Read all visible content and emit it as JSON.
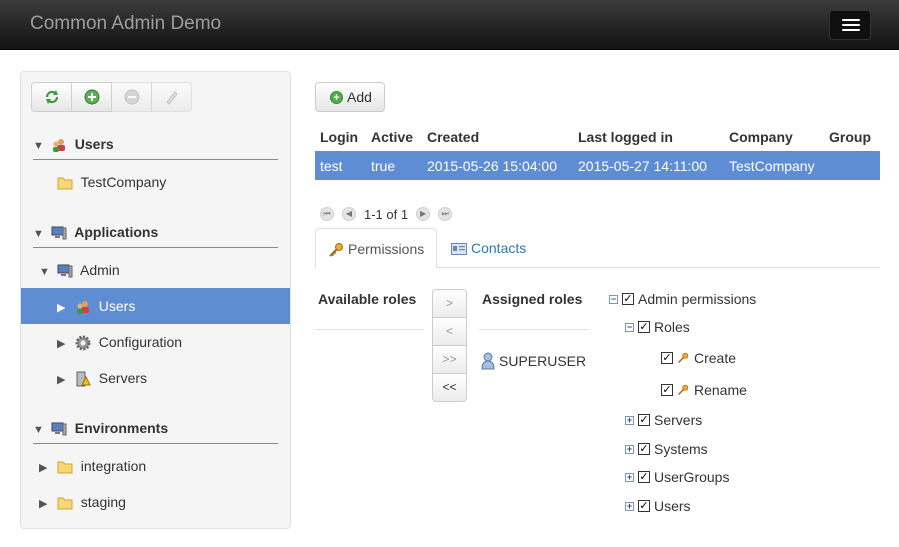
{
  "app": {
    "title": "Common Admin Demo"
  },
  "toolbar": {
    "refresh": "refresh-icon",
    "add": "add-icon",
    "remove": "remove-icon",
    "edit": "edit-icon"
  },
  "sidebar": {
    "users_section": "Users",
    "users_company": "TestCompany",
    "applications_section": "Applications",
    "app_admin": "Admin",
    "admin_users": "Users",
    "admin_configuration": "Configuration",
    "admin_servers": "Servers",
    "environments_section": "Environments",
    "env_integration": "integration",
    "env_staging": "staging"
  },
  "main": {
    "add_label": "Add",
    "table": {
      "headers": [
        "Login",
        "Active",
        "Created",
        "Last logged in",
        "Company",
        "Group"
      ],
      "rows": [
        [
          "test",
          "true",
          "2015-05-26 15:04:00",
          "2015-05-27 14:11:00",
          "TestCompany",
          ""
        ]
      ]
    },
    "pager": {
      "text": "1-1 of 1"
    },
    "tabs": [
      "Permissions",
      "Contacts"
    ],
    "roles": {
      "available_title": "Available roles",
      "assigned_title": "Assigned roles",
      "move_buttons": [
        ">",
        "<",
        ">>",
        "<<"
      ],
      "assigned": [
        "SUPERUSER"
      ]
    },
    "permissions_tree": {
      "root": "Admin permissions",
      "roles": "Roles",
      "create": "Create",
      "rename": "Rename",
      "servers": "Servers",
      "systems": "Systems",
      "usergroups": "UserGroups",
      "users": "Users"
    }
  },
  "colors": {
    "selection": "#5f8dd3",
    "navbar": "#222222",
    "link": "#2a7ab3"
  }
}
